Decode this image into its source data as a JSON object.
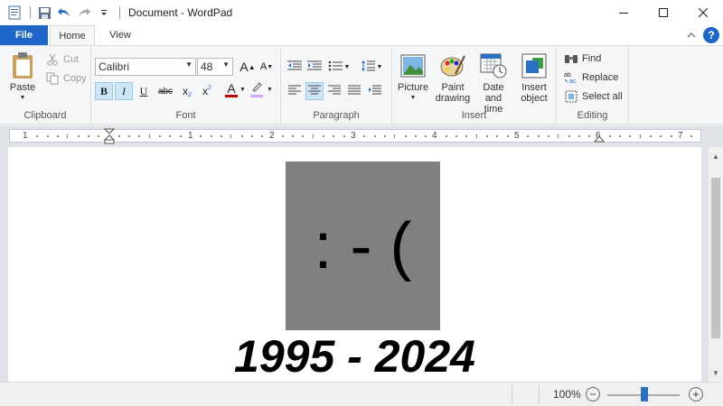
{
  "window": {
    "title": "Document - WordPad",
    "minimize_icon": "minimize-icon",
    "maximize_icon": "maximize-icon",
    "close_icon": "close-icon"
  },
  "quick_access": {
    "icons": [
      "wordpad-icon",
      "save-icon",
      "undo-icon",
      "redo-icon",
      "customize-dropdown-icon"
    ]
  },
  "tabs": {
    "file": "File",
    "home": "Home",
    "view": "View"
  },
  "ribbon": {
    "clipboard": {
      "label": "Clipboard",
      "paste": "Paste",
      "cut": "Cut",
      "copy": "Copy"
    },
    "font": {
      "label": "Font",
      "family": "Calibri",
      "size": "48",
      "grow_glyph": "A",
      "shrink_glyph": "A",
      "bold_glyph": "B",
      "italic_glyph": "I",
      "underline_glyph": "U",
      "strike_glyph": "abc",
      "subscript_glyph": "x",
      "superscript_glyph": "x",
      "color_glyph": "A",
      "text_color": "#c00000",
      "highlight_color": "#d4a5ff"
    },
    "paragraph": {
      "label": "Paragraph"
    },
    "insert": {
      "label": "Insert",
      "picture": "Picture",
      "paint_drawing": "Paint\ndrawing",
      "date_time": "Date and\ntime",
      "insert_object": "Insert\nobject"
    },
    "editing": {
      "label": "Editing",
      "find": "Find",
      "replace": "Replace",
      "select_all": "Select all"
    }
  },
  "ruler": {
    "numbers": [
      "1",
      "1",
      "2",
      "3",
      "4",
      "5",
      "6",
      "7"
    ]
  },
  "document": {
    "emoticon": ": - (",
    "emoticon_bg": "#808080",
    "years": "1995 - 2024"
  },
  "status": {
    "zoom": "100%",
    "zoom_level_percent": 100
  },
  "colors": {
    "accent": "#1e66c7",
    "ribbon_bg": "#f5f6f7"
  }
}
